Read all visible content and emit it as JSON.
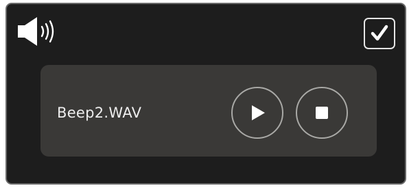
{
  "icons": {
    "speaker": "speaker-volume-icon",
    "confirm": "checkmark-icon",
    "play": "play-icon",
    "stop": "stop-icon"
  },
  "player": {
    "file_name": "Beep2.WAV"
  },
  "colors": {
    "panel_background": "#1d1d1d",
    "panel_border": "#6a6a6a",
    "card_background": "#3a3937",
    "button_ring": "#a9a9a6",
    "foreground": "#ffffff"
  }
}
